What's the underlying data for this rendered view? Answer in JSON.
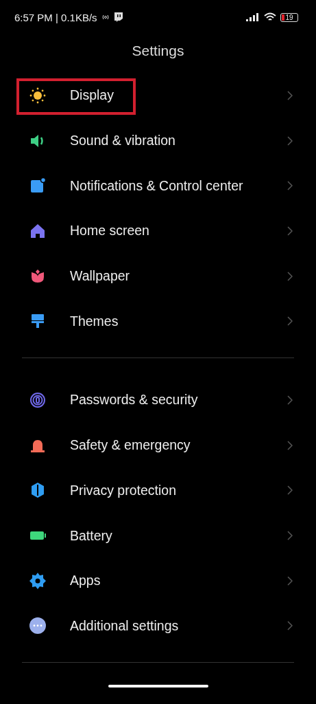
{
  "status_bar": {
    "time": "6:57 PM | 0.1KB/s",
    "battery": "19"
  },
  "title": "Settings",
  "groups": [
    {
      "items": [
        {
          "label": "Display",
          "color": "#f7bd3b",
          "highlighted": true
        },
        {
          "label": "Sound & vibration",
          "color": "#3ecf85",
          "highlighted": false
        },
        {
          "label": "Notifications & Control center",
          "color": "#3a9cf5",
          "highlighted": false
        },
        {
          "label": "Home screen",
          "color": "#7b73f0",
          "highlighted": false
        },
        {
          "label": "Wallpaper",
          "color": "#f0587a",
          "highlighted": false
        },
        {
          "label": "Themes",
          "color": "#3a9cf5",
          "highlighted": false
        }
      ]
    },
    {
      "items": [
        {
          "label": "Passwords & security",
          "color": "#6f68e8",
          "highlighted": false
        },
        {
          "label": "Safety & emergency",
          "color": "#f36b57",
          "highlighted": false
        },
        {
          "label": "Privacy protection",
          "color": "#2f9df2",
          "highlighted": false
        },
        {
          "label": "Battery",
          "color": "#3ed77c",
          "highlighted": false
        },
        {
          "label": "Apps",
          "color": "#2f9df2",
          "highlighted": false
        },
        {
          "label": "Additional settings",
          "color": "#9cb0ec",
          "highlighted": false
        }
      ]
    }
  ]
}
